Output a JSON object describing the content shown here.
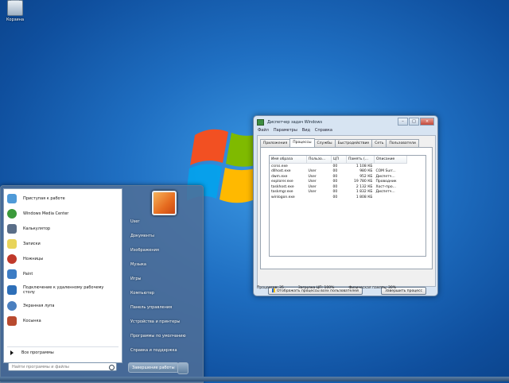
{
  "desktop": {
    "recycle_bin_label": "Корзина"
  },
  "start_menu": {
    "pinned": [
      {
        "label": "Приступая к работе",
        "icon": "getting-started-icon",
        "color": "#4f9ad8"
      },
      {
        "label": "Windows Media Center",
        "icon": "media-center-icon",
        "color": "#3b9a3b"
      },
      {
        "label": "Калькулятор",
        "icon": "calculator-icon",
        "color": "#5a6e88"
      },
      {
        "label": "Записки",
        "icon": "sticky-notes-icon",
        "color": "#e8d45a"
      },
      {
        "label": "Ножницы",
        "icon": "scissors-icon",
        "color": "#c0392b"
      },
      {
        "label": "Paint",
        "icon": "paint-icon",
        "color": "#3c7cc4"
      },
      {
        "label": "Подключение к удаленному рабочему столу",
        "icon": "remote-desktop-icon",
        "color": "#2d6fb8"
      },
      {
        "label": "Экранная лупа",
        "icon": "magnifier-icon",
        "color": "#4a7fbf"
      },
      {
        "label": "Косынка",
        "icon": "solitaire-icon",
        "color": "#b84a2f"
      }
    ],
    "all_programs": "Все программы",
    "search_placeholder": "Найти программы и файлы",
    "right_items": [
      "User",
      "Документы",
      "Изображения",
      "Музыка",
      "Игры",
      "Компьютер",
      "Панель управления",
      "Устройства и принтеры",
      "Программы по умолчанию",
      "Справка и поддержка"
    ],
    "shutdown_label": "Завершение работы"
  },
  "task_manager": {
    "title": "Диспетчер задач Windows",
    "menu": [
      "Файл",
      "Параметры",
      "Вид",
      "Справка"
    ],
    "tabs": [
      "Приложения",
      "Процессы",
      "Службы",
      "Быстродействие",
      "Сеть",
      "Пользователи"
    ],
    "active_tab": "Процессы",
    "columns": [
      "Имя образа",
      "Пользо...",
      "ЦП",
      "Память (...",
      "Описание"
    ],
    "rows": [
      {
        "name": "csrss.exe",
        "user": "",
        "cpu": "00",
        "mem": "1 108 КБ",
        "desc": ""
      },
      {
        "name": "dllhost.exe",
        "user": "User",
        "cpu": "00",
        "mem": "980 КБ",
        "desc": "COM Surr..."
      },
      {
        "name": "dwm.exe",
        "user": "User",
        "cpu": "00",
        "mem": "952 КБ",
        "desc": "Диспетч..."
      },
      {
        "name": "explorer.exe",
        "user": "User",
        "cpu": "00",
        "mem": "19 780 КБ",
        "desc": "Проводник"
      },
      {
        "name": "taskhost.exe",
        "user": "User",
        "cpu": "00",
        "mem": "2 132 КБ",
        "desc": "Хост-про..."
      },
      {
        "name": "taskmgr.exe",
        "user": "User",
        "cpu": "00",
        "mem": "1 832 КБ",
        "desc": "Диспетч..."
      },
      {
        "name": "winlogon.exe",
        "user": "",
        "cpu": "00",
        "mem": "1 808 КБ",
        "desc": ""
      }
    ],
    "show_all_button": "Отображать процессы всех пользователей",
    "end_process_button": "Завершить процесс",
    "status": {
      "processes": "Процессов: 35",
      "cpu": "Загрузка ЦП: 100%",
      "memory": "Физическая память: 30%"
    }
  }
}
